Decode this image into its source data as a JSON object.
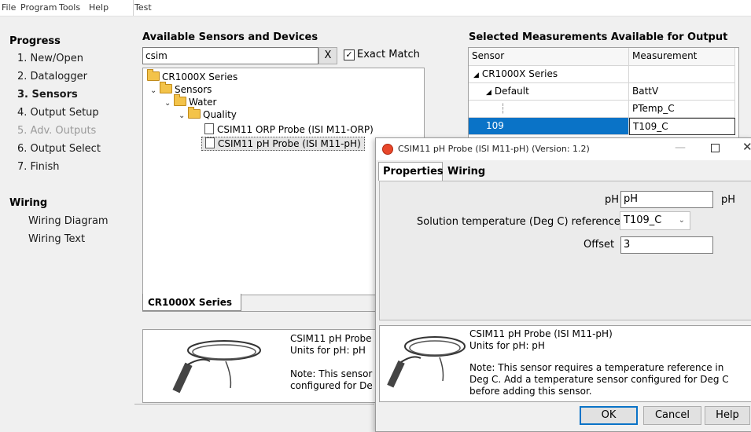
{
  "menu": [
    "File",
    "Program",
    "Tools",
    "Help",
    "Test"
  ],
  "sidebar": {
    "progress_title": "Progress",
    "steps": [
      "1. New/Open",
      "2. Datalogger",
      "3. Sensors",
      "4. Output Setup",
      "5. Adv. Outputs",
      "6. Output Select",
      "7. Finish"
    ],
    "wiring_title": "Wiring",
    "wiring_items": [
      "Wiring Diagram",
      "Wiring Text"
    ]
  },
  "sensors_panel": {
    "title": "Available Sensors and Devices",
    "search_value": "csim",
    "clear_label": "X",
    "exact_match_label": "Exact Match",
    "tree": [
      "CR1000X Series",
      "Sensors",
      "Water",
      "Quality",
      "CSIM11 ORP Probe (ISI M11-ORP)",
      "CSIM11 pH Probe (ISI M11-pH)"
    ],
    "tab_label": "CR1000X Series",
    "desc_lines": [
      "CSIM11 pH Probe",
      "Units for pH: pH",
      "Note: This sensor",
      "configured for De"
    ]
  },
  "outputs_panel": {
    "title": "Selected Measurements Available for Output",
    "col_sensor": "Sensor",
    "col_measurement": "Measurement",
    "rows": [
      {
        "sensor": "CR1000X Series",
        "measurement": ""
      },
      {
        "sensor": "Default",
        "measurement": "BattV"
      },
      {
        "sensor": "",
        "measurement": "PTemp_C"
      },
      {
        "sensor": "109",
        "measurement": "T109_C"
      }
    ]
  },
  "dialog": {
    "title": "CSIM11 pH Probe (ISI M11-pH) (Version: 1.2)",
    "tab_properties": "Properties",
    "tab_wiring": "Wiring",
    "ph_label": "pH",
    "ph_value": "pH",
    "ph_unit": "pH",
    "temp_label": "Solution temperature (Deg C) reference",
    "temp_value": "T109_C",
    "offset_label": "Offset",
    "offset_value": "3",
    "desc_lines": [
      "CSIM11 pH Probe (ISI M11-pH)",
      "Units for pH: pH",
      "Note: This sensor requires a temperature reference in",
      "Deg C. Add a temperature sensor configured for Deg C",
      "before adding this sensor."
    ],
    "ok_label": "OK",
    "cancel_label": "Cancel",
    "help_label": "Help"
  },
  "colors": {
    "selection": "#0a73c7",
    "folder": "#f3c34a",
    "dialog_icon": "#e8472b"
  }
}
